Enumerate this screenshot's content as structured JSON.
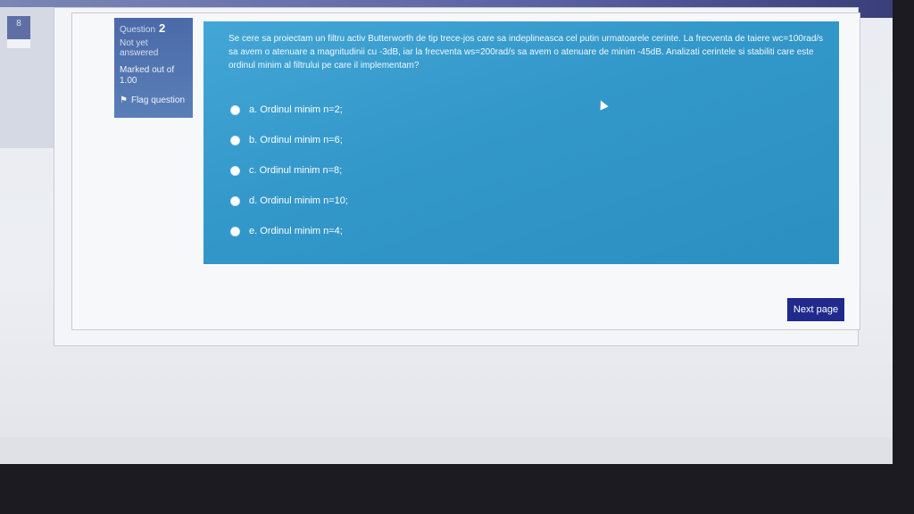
{
  "nav": {
    "current_page": "8"
  },
  "question": {
    "label": "Question",
    "number": "2",
    "status": "Not yet answered",
    "marks": "Marked out of 1.00",
    "flag_label": "Flag question",
    "text": "Se cere sa proiectam un filtru activ Butterworth de tip trece-jos care sa indeplineasca cel putin urmatoarele cerinte. La frecventa de taiere wc=100rad/s sa avem o atenuare a magnitudinii cu -3dB, iar la frecventa ws=200rad/s sa avem o atenuare de minim -45dB. Analizati cerintele si stabiliti care este ordinul minim al filtrului pe care il implementam?",
    "answers": [
      {
        "label": "a. Ordinul minim n=2;"
      },
      {
        "label": "b. Ordinul minim n=6;"
      },
      {
        "label": "c. Ordinul minim n=8;"
      },
      {
        "label": "d. Ordinul minim n=10;"
      },
      {
        "label": "e. Ordinul minim n=4;"
      }
    ]
  },
  "navigation": {
    "next_label": "Next page"
  },
  "colors": {
    "panel": "#3297c9",
    "button": "#1f2a8c",
    "info": "#5a7fb8"
  },
  "icons": {
    "flag": "flag-icon",
    "cursor": "mouse-cursor-icon"
  }
}
